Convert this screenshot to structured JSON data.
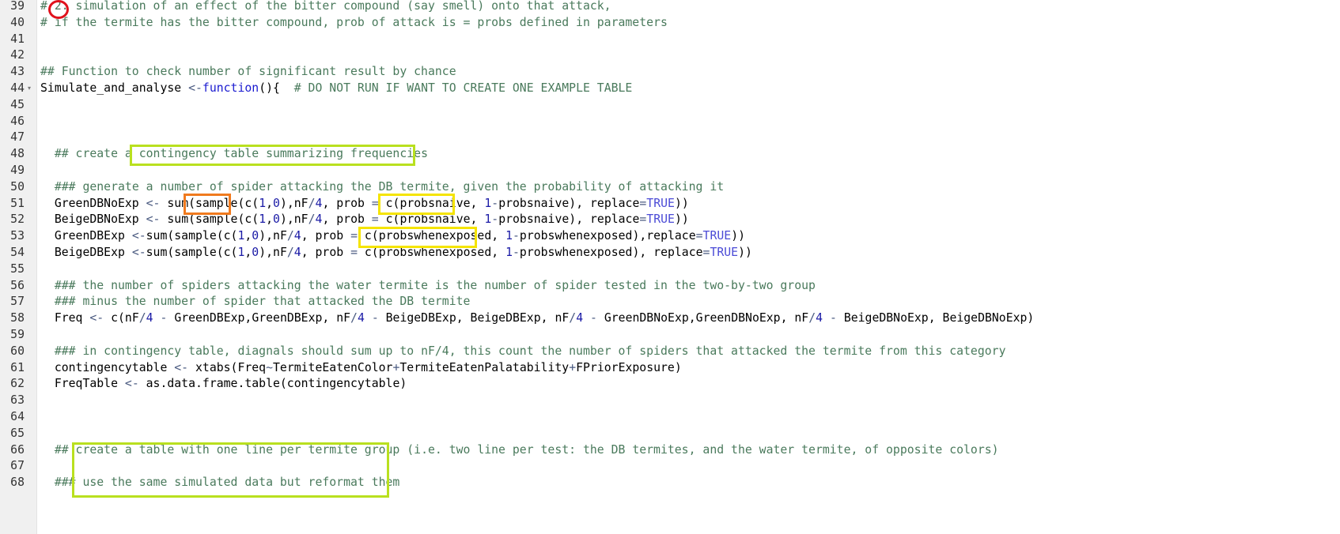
{
  "editor": {
    "lines": [
      {
        "n": "39",
        "tokens": [
          [
            "comment",
            "# 2. simulation of an effect of the bitter compound (say smell) onto that attack,"
          ]
        ]
      },
      {
        "n": "40",
        "tokens": [
          [
            "comment",
            "# if the termite has the bitter compound, prob of attack is = probs defined in parameters"
          ]
        ]
      },
      {
        "n": "41",
        "tokens": []
      },
      {
        "n": "42",
        "tokens": []
      },
      {
        "n": "43",
        "tokens": [
          [
            "comment",
            "## Function to check number of significant result by chance"
          ]
        ]
      },
      {
        "n": "44",
        "fold": true,
        "tokens": [
          [
            "text",
            "Simulate_and_analyse "
          ],
          [
            "op",
            "<-"
          ],
          [
            "kw",
            "function"
          ],
          [
            "text",
            "(){  "
          ],
          [
            "comment",
            "# DO NOT RUN IF WANT TO CREATE ONE EXAMPLE TABLE"
          ]
        ]
      },
      {
        "n": "45",
        "tokens": []
      },
      {
        "n": "46",
        "tokens": []
      },
      {
        "n": "47",
        "tokens": []
      },
      {
        "n": "48",
        "tokens": [
          [
            "text",
            "  "
          ],
          [
            "comment",
            "## create a contingency table summarizing frequencies"
          ]
        ]
      },
      {
        "n": "49",
        "tokens": []
      },
      {
        "n": "50",
        "tokens": [
          [
            "text",
            "  "
          ],
          [
            "comment",
            "### generate a number of spider attacking the DB termite, given the probability of attacking it"
          ]
        ]
      },
      {
        "n": "51",
        "tokens": [
          [
            "text",
            "  GreenDBNoExp "
          ],
          [
            "op",
            "<-"
          ],
          [
            "text",
            " sum(sample(c("
          ],
          [
            "number",
            "1"
          ],
          [
            "text",
            ","
          ],
          [
            "number",
            "0"
          ],
          [
            "text",
            "),nF"
          ],
          [
            "op",
            "/"
          ],
          [
            "number",
            "4"
          ],
          [
            "text",
            ", prob "
          ],
          [
            "op",
            "="
          ],
          [
            "text",
            " c(probsnaive, "
          ],
          [
            "number",
            "1"
          ],
          [
            "op",
            "-"
          ],
          [
            "text",
            "probsnaive), replace"
          ],
          [
            "op",
            "="
          ],
          [
            "const",
            "TRUE"
          ],
          [
            "text",
            "))"
          ]
        ]
      },
      {
        "n": "52",
        "tokens": [
          [
            "text",
            "  BeigeDBNoExp "
          ],
          [
            "op",
            "<-"
          ],
          [
            "text",
            " sum(sample(c("
          ],
          [
            "number",
            "1"
          ],
          [
            "text",
            ","
          ],
          [
            "number",
            "0"
          ],
          [
            "text",
            "),nF"
          ],
          [
            "op",
            "/"
          ],
          [
            "number",
            "4"
          ],
          [
            "text",
            ", prob "
          ],
          [
            "op",
            "="
          ],
          [
            "text",
            " c(probsnaive, "
          ],
          [
            "number",
            "1"
          ],
          [
            "op",
            "-"
          ],
          [
            "text",
            "probsnaive), replace"
          ],
          [
            "op",
            "="
          ],
          [
            "const",
            "TRUE"
          ],
          [
            "text",
            "))"
          ]
        ]
      },
      {
        "n": "53",
        "tokens": [
          [
            "text",
            "  GreenDBExp "
          ],
          [
            "op",
            "<-"
          ],
          [
            "text",
            "sum(sample(c("
          ],
          [
            "number",
            "1"
          ],
          [
            "text",
            ","
          ],
          [
            "number",
            "0"
          ],
          [
            "text",
            "),nF"
          ],
          [
            "op",
            "/"
          ],
          [
            "number",
            "4"
          ],
          [
            "text",
            ", prob "
          ],
          [
            "op",
            "="
          ],
          [
            "text",
            " c(probswhenexposed, "
          ],
          [
            "number",
            "1"
          ],
          [
            "op",
            "-"
          ],
          [
            "text",
            "probswhenexposed),replace"
          ],
          [
            "op",
            "="
          ],
          [
            "const",
            "TRUE"
          ],
          [
            "text",
            "))"
          ]
        ]
      },
      {
        "n": "54",
        "tokens": [
          [
            "text",
            "  BeigeDBExp "
          ],
          [
            "op",
            "<-"
          ],
          [
            "text",
            "sum(sample(c("
          ],
          [
            "number",
            "1"
          ],
          [
            "text",
            ","
          ],
          [
            "number",
            "0"
          ],
          [
            "text",
            "),nF"
          ],
          [
            "op",
            "/"
          ],
          [
            "number",
            "4"
          ],
          [
            "text",
            ", prob "
          ],
          [
            "op",
            "="
          ],
          [
            "text",
            " c(probswhenexposed, "
          ],
          [
            "number",
            "1"
          ],
          [
            "op",
            "-"
          ],
          [
            "text",
            "probswhenexposed), replace"
          ],
          [
            "op",
            "="
          ],
          [
            "const",
            "TRUE"
          ],
          [
            "text",
            "))"
          ]
        ]
      },
      {
        "n": "55",
        "tokens": []
      },
      {
        "n": "56",
        "tokens": [
          [
            "text",
            "  "
          ],
          [
            "comment",
            "### the number of spiders attacking the water termite is the number of spider tested in the two-by-two group"
          ]
        ]
      },
      {
        "n": "57",
        "tokens": [
          [
            "text",
            "  "
          ],
          [
            "comment",
            "### minus the number of spider that attacked the DB termite"
          ]
        ]
      },
      {
        "n": "58",
        "tokens": [
          [
            "text",
            "  Freq "
          ],
          [
            "op",
            "<-"
          ],
          [
            "text",
            " c(nF"
          ],
          [
            "op",
            "/"
          ],
          [
            "number",
            "4"
          ],
          [
            "text",
            " "
          ],
          [
            "op",
            "-"
          ],
          [
            "text",
            " GreenDBExp,GreenDBExp, nF"
          ],
          [
            "op",
            "/"
          ],
          [
            "number",
            "4"
          ],
          [
            "text",
            " "
          ],
          [
            "op",
            "-"
          ],
          [
            "text",
            " BeigeDBExp, BeigeDBExp, nF"
          ],
          [
            "op",
            "/"
          ],
          [
            "number",
            "4"
          ],
          [
            "text",
            " "
          ],
          [
            "op",
            "-"
          ],
          [
            "text",
            " GreenDBNoExp,GreenDBNoExp, nF"
          ],
          [
            "op",
            "/"
          ],
          [
            "number",
            "4"
          ],
          [
            "text",
            " "
          ],
          [
            "op",
            "-"
          ],
          [
            "text",
            " BeigeDBNoExp, BeigeDBNoExp)"
          ]
        ]
      },
      {
        "n": "59",
        "tokens": []
      },
      {
        "n": "60",
        "tokens": [
          [
            "text",
            "  "
          ],
          [
            "comment",
            "### in contingency table, diagnals should sum up to nF/4, this count the number of spiders that attacked the termite from this category"
          ]
        ]
      },
      {
        "n": "61",
        "tokens": [
          [
            "text",
            "  contingencytable "
          ],
          [
            "op",
            "<-"
          ],
          [
            "text",
            " xtabs(Freq"
          ],
          [
            "op",
            "~"
          ],
          [
            "text",
            "TermiteEatenColor"
          ],
          [
            "op",
            "+"
          ],
          [
            "text",
            "TermiteEatenPalatability"
          ],
          [
            "op",
            "+"
          ],
          [
            "text",
            "FPriorExposure)"
          ]
        ]
      },
      {
        "n": "62",
        "tokens": [
          [
            "text",
            "  FreqTable "
          ],
          [
            "op",
            "<-"
          ],
          [
            "text",
            " as.data.frame.table(contingencytable)"
          ]
        ]
      },
      {
        "n": "63",
        "tokens": []
      },
      {
        "n": "64",
        "tokens": []
      },
      {
        "n": "65",
        "tokens": []
      },
      {
        "n": "66",
        "tokens": [
          [
            "text",
            "  "
          ],
          [
            "comment",
            "## create a table with one line per termite group (i.e. two line per test: the DB termites, and the water termite, of opposite colors)"
          ]
        ]
      },
      {
        "n": "67",
        "tokens": []
      },
      {
        "n": "68",
        "tokens": [
          [
            "text",
            "  "
          ],
          [
            "comment",
            "### use the same simulated data but reformat them"
          ]
        ]
      }
    ]
  },
  "annotations": {
    "circle_color": "#e0121c",
    "green_color": "#b9e01f",
    "yellow_color": "#f5e400",
    "orange_color": "#f07a1e"
  }
}
